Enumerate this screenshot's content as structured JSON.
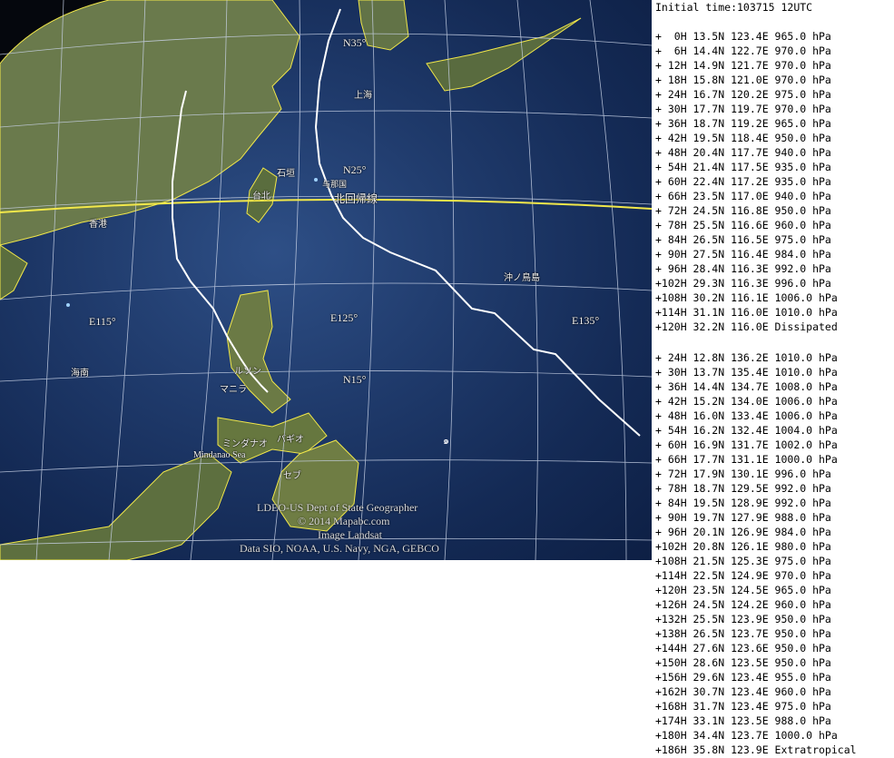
{
  "header": {
    "initial_time": "Initial time:103715 12UTC"
  },
  "map": {
    "grid_labels": [
      "N35°",
      "N25°",
      "N15°",
      "E115°",
      "E125°",
      "E135°"
    ],
    "place_labels": [
      "上海",
      "石垣",
      "台北",
      "与那国",
      "北回帰線",
      "香港",
      "海南",
      "ルソン",
      "マニラ",
      "バギオ",
      "ミンダナオ",
      "セブ",
      "Mindanao Sea",
      "沖ノ鳥島"
    ],
    "credits": [
      "LDEO-US Dept of State Geographer",
      "© 2014 Mapabc.com",
      "Image Landsat",
      "Data SIO, NOAA, U.S. Navy, NGA, GEBCO"
    ],
    "colors": {
      "track": "#ffffff",
      "coast": "#f2e84a",
      "tropic": "#f2e84a",
      "grid": "#c8d2e6"
    }
  },
  "forecast_track_1": [
    "+  0H 13.5N 123.4E 965.0 hPa",
    "+  6H 14.4N 122.7E 970.0 hPa",
    "+ 12H 14.9N 121.7E 970.0 hPa",
    "+ 18H 15.8N 121.0E 970.0 hPa",
    "+ 24H 16.7N 120.2E 975.0 hPa",
    "+ 30H 17.7N 119.7E 970.0 hPa",
    "+ 36H 18.7N 119.2E 965.0 hPa",
    "+ 42H 19.5N 118.4E 950.0 hPa",
    "+ 48H 20.4N 117.7E 940.0 hPa",
    "+ 54H 21.4N 117.5E 935.0 hPa",
    "+ 60H 22.4N 117.2E 935.0 hPa",
    "+ 66H 23.5N 117.0E 940.0 hPa",
    "+ 72H 24.5N 116.8E 950.0 hPa",
    "+ 78H 25.5N 116.6E 960.0 hPa",
    "+ 84H 26.5N 116.5E 975.0 hPa",
    "+ 90H 27.5N 116.4E 984.0 hPa",
    "+ 96H 28.4N 116.3E 992.0 hPa",
    "+102H 29.3N 116.3E 996.0 hPa",
    "+108H 30.2N 116.1E 1006.0 hPa",
    "+114H 31.1N 116.0E 1010.0 hPa",
    "+120H 32.2N 116.0E Dissipated"
  ],
  "forecast_track_2": [
    "+ 24H 12.8N 136.2E 1010.0 hPa",
    "+ 30H 13.7N 135.4E 1010.0 hPa",
    "+ 36H 14.4N 134.7E 1008.0 hPa",
    "+ 42H 15.2N 134.0E 1006.0 hPa",
    "+ 48H 16.0N 133.4E 1006.0 hPa",
    "+ 54H 16.2N 132.4E 1004.0 hPa",
    "+ 60H 16.9N 131.7E 1002.0 hPa",
    "+ 66H 17.7N 131.1E 1000.0 hPa",
    "+ 72H 17.9N 130.1E 996.0 hPa",
    "+ 78H 18.7N 129.5E 992.0 hPa",
    "+ 84H 19.5N 128.9E 992.0 hPa",
    "+ 90H 19.7N 127.9E 988.0 hPa",
    "+ 96H 20.1N 126.9E 984.0 hPa",
    "+102H 20.8N 126.1E 980.0 hPa",
    "+108H 21.5N 125.3E 975.0 hPa",
    "+114H 22.5N 124.9E 970.0 hPa",
    "+120H 23.5N 124.5E 965.0 hPa",
    "+126H 24.5N 124.2E 960.0 hPa",
    "+132H 25.5N 123.9E 950.0 hPa",
    "+138H 26.5N 123.7E 950.0 hPa",
    "+144H 27.6N 123.6E 950.0 hPa",
    "+150H 28.6N 123.5E 950.0 hPa",
    "+156H 29.6N 123.4E 955.0 hPa",
    "+162H 30.7N 123.4E 960.0 hPa",
    "+168H 31.7N 123.4E 975.0 hPa",
    "+174H 33.1N 123.5E 988.0 hPa",
    "+180H 34.4N 123.7E 1000.0 hPa",
    "+186H 35.8N 123.9E Extratropical"
  ]
}
